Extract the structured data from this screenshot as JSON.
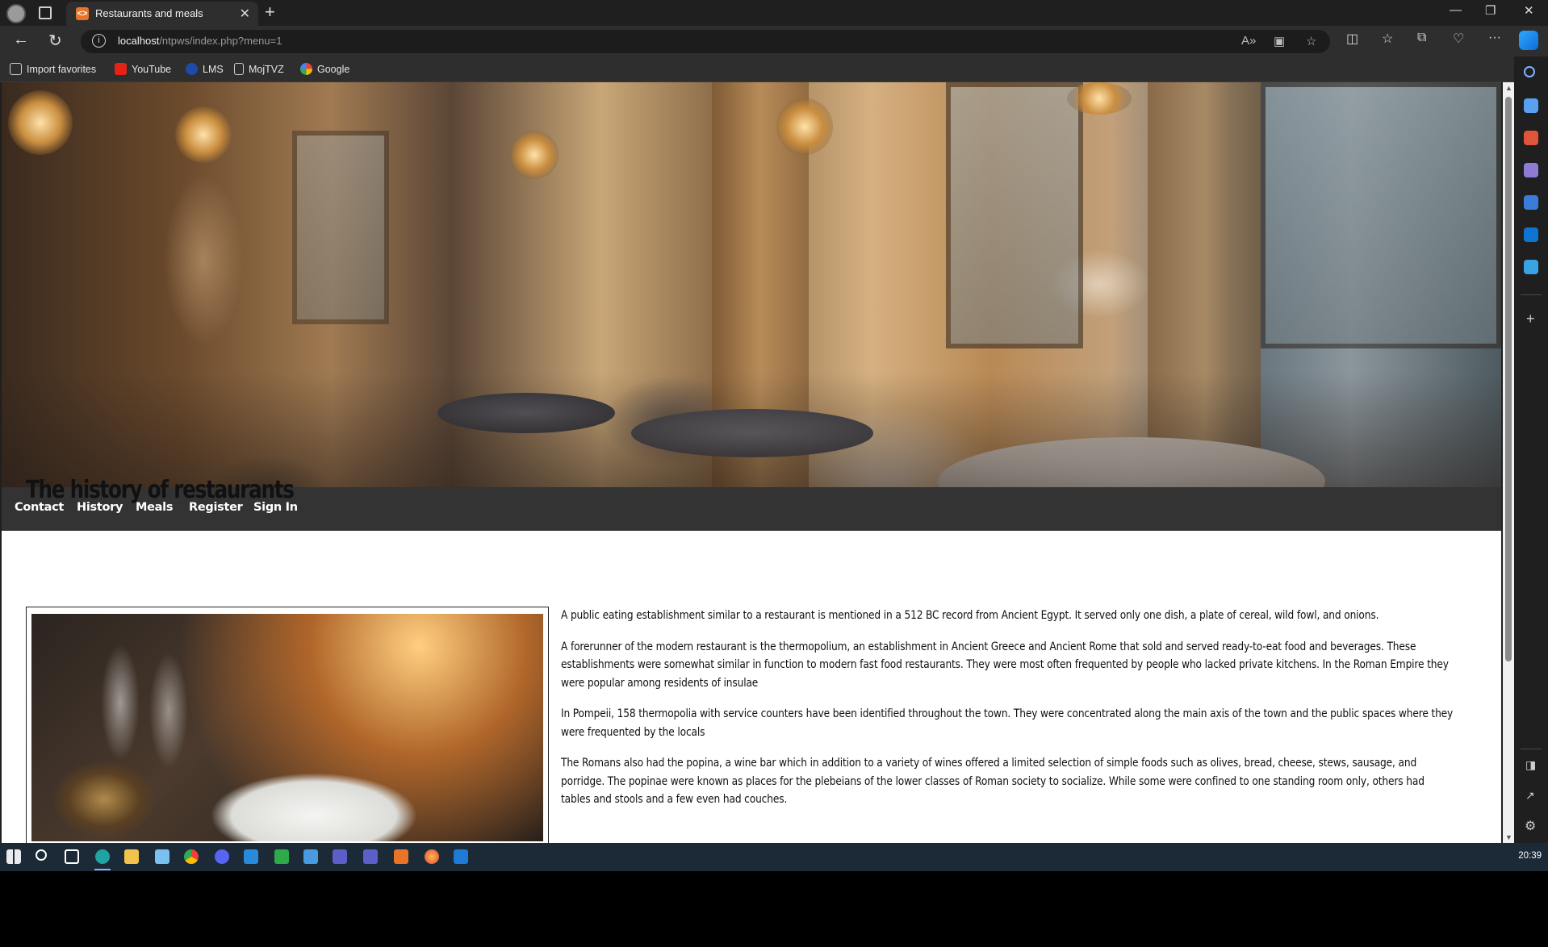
{
  "browser": {
    "tab_title": "Restaurants and meals",
    "tab_favicon": "<>",
    "url_host": "localhost",
    "url_path": "/ntpws/index.php?menu=1",
    "favorites": [
      {
        "label": "Import favorites",
        "icon": "import-icon"
      },
      {
        "label": "YouTube",
        "icon": "youtube-icon"
      },
      {
        "label": "LMS",
        "icon": "lms-icon"
      },
      {
        "label": "MojTVZ",
        "icon": "page-icon"
      },
      {
        "label": "Google",
        "icon": "google-icon"
      }
    ]
  },
  "site": {
    "nav": [
      "Contact",
      "History",
      "Meals",
      "Register",
      "Sign In"
    ],
    "title": "The history of restaurants",
    "paragraphs": [
      "A public eating establishment similar to a restaurant is mentioned in a 512 BC record from Ancient Egypt. It served only one dish, a plate of cereal, wild fowl, and onions.",
      "A forerunner of the modern restaurant is the thermopolium, an establishment in Ancient Greece and Ancient Rome that sold and served ready-to-eat food and beverages. These establishments were somewhat similar in function to modern fast food restaurants. They were most often frequented by people who lacked private kitchens. In the Roman Empire they were popular among residents of insulae",
      "In Pompeii, 158 thermopolia with service counters have been identified throughout the town. They were concentrated along the main axis of the town and the public spaces where they were frequented by the locals",
      "The Romans also had the popina, a wine bar which in addition to a variety of wines offered a limited selection of simple foods such as olives, bread, cheese, stews, sausage, and porridge. The popinae were known as places for the plebeians of the lower classes of Roman society to socialize. While some were confined to one standing room only, others had tables and stools and a few even had couches."
    ]
  },
  "taskbar": {
    "clock": "20:39"
  },
  "colors": {
    "nav_bg": "#333333",
    "browser_bg": "#2e2e2e",
    "taskbar_bg": "#1b2a36"
  }
}
